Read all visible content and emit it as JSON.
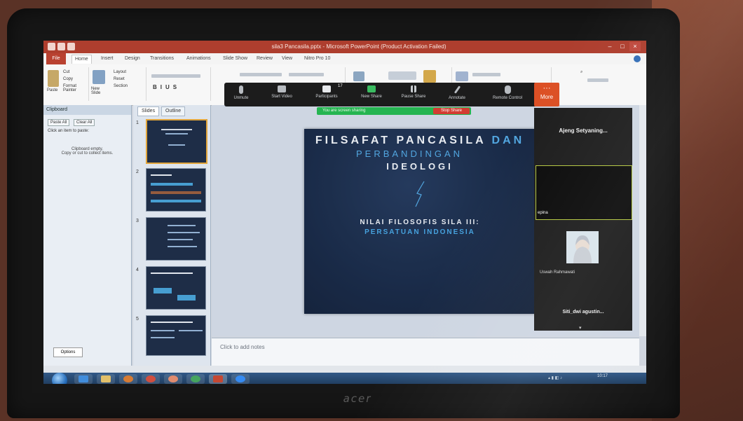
{
  "window": {
    "title": "sila3 Pancasila.pptx - Microsoft PowerPoint (Product Activation Failed)",
    "quick_access_icons": [
      "save-icon",
      "undo-icon",
      "redo-icon"
    ],
    "controls": [
      "minimize-icon",
      "maximize-icon",
      "close-icon"
    ]
  },
  "ribbon": {
    "file_tab": "File",
    "tabs": [
      "Home",
      "Insert",
      "Design",
      "Transitions",
      "Animations",
      "Slide Show",
      "Review",
      "View",
      "Nitro Pro 10"
    ],
    "clipboard": {
      "paste": "Paste",
      "cut": "Cut",
      "copy": "Copy",
      "format_painter": "Format Painter"
    },
    "slides": {
      "new_slide": "New Slide",
      "layout": "Layout",
      "reset": "Reset",
      "section": "Section"
    }
  },
  "clipboard_pane": {
    "header": "Clipboard",
    "paste_all": "Paste All",
    "clear_all": "Clear All",
    "hint": "Click an item to paste:",
    "empty_title": "Clipboard empty.",
    "empty_hint": "Copy or cut to collect items.",
    "options": "Options"
  },
  "slides_pane": {
    "tabs": [
      "Slides",
      "Outline"
    ],
    "thumbnails": [
      {
        "number": "1",
        "selected": true
      },
      {
        "number": "2",
        "selected": false
      },
      {
        "number": "3",
        "selected": false
      },
      {
        "number": "4",
        "selected": false
      },
      {
        "number": "5",
        "selected": false
      }
    ]
  },
  "slide": {
    "title_line1_white": "FILSAFAT PANCASILA ",
    "title_line1_blue": "DAN",
    "title_line2": "PERBANDINGAN",
    "title_line3": "IDEOLOGI",
    "subtitle_line1": "NILAI FILOSOFIS SILA III:",
    "subtitle_line2": "PERSATUAN INDONESIA"
  },
  "notes": {
    "placeholder": "Click to add notes"
  },
  "zoom_toolbar": {
    "buttons": [
      {
        "label": "Unmute",
        "icon": "microphone-icon"
      },
      {
        "label": "Start Video",
        "icon": "video-icon"
      },
      {
        "label": "Participants",
        "icon": "participants-icon",
        "count": "17"
      },
      {
        "label": "New Share",
        "icon": "share-screen-icon"
      },
      {
        "label": "Pause Share",
        "icon": "pause-icon"
      },
      {
        "label": "Annotate",
        "icon": "pen-icon"
      },
      {
        "label": "Remote Control",
        "icon": "remote-control-icon"
      }
    ],
    "more": "More",
    "sharing_banner": "You are screen sharing",
    "stop_share": "Stop Share"
  },
  "participants_panel": {
    "participants": [
      {
        "name": "Ajeng Setyaning..."
      },
      {
        "name": "epina"
      },
      {
        "name": "Uswah Rahmawati"
      },
      {
        "name": "Siti_dwi agustin..."
      }
    ]
  },
  "taskbar": {
    "apps": [
      "ie-icon",
      "explorer-icon",
      "media-icon",
      "chrome-icon",
      "paint-icon",
      "chrome-icon",
      "powerpoint-icon",
      "zoom-icon"
    ],
    "time": "10:17"
  },
  "device": {
    "brand": "acer"
  },
  "colors": {
    "powerpoint_red": "#b83b2a",
    "slide_bg": "#172a4a",
    "slide_accent": "#4aa8e8",
    "zoom_green": "#19b94a",
    "zoom_stop": "#e03a2d",
    "zoom_more": "#e94d1d"
  }
}
